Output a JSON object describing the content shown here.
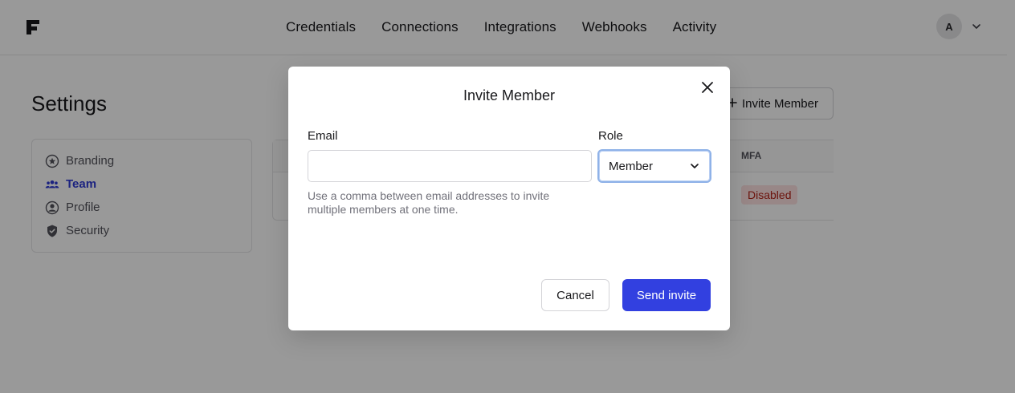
{
  "nav": {
    "items": [
      "Credentials",
      "Connections",
      "Integrations",
      "Webhooks",
      "Activity"
    ],
    "avatar_initial": "A"
  },
  "settings": {
    "title": "Settings",
    "sidebar": [
      {
        "label": "Branding",
        "icon": "star-circle-icon"
      },
      {
        "label": "Team",
        "icon": "users-icon",
        "active": true
      },
      {
        "label": "Profile",
        "icon": "user-circle-icon"
      },
      {
        "label": "Security",
        "icon": "shield-check-icon"
      }
    ],
    "invite_button": "Invite Member",
    "table": {
      "mfa_header": "MFA",
      "mfa_status": "Disabled"
    }
  },
  "modal": {
    "title": "Invite Member",
    "email_label": "Email",
    "email_value": "",
    "helper": "Use a comma between email addresses to invite multiple members at one time.",
    "role_label": "Role",
    "role_value": "Member",
    "cancel": "Cancel",
    "send": "Send invite"
  },
  "colors": {
    "accent": "#3240e0",
    "active_nav": "#2f3bd6",
    "danger_badge_bg": "#fde2e2",
    "danger_badge_text": "#b42318"
  }
}
